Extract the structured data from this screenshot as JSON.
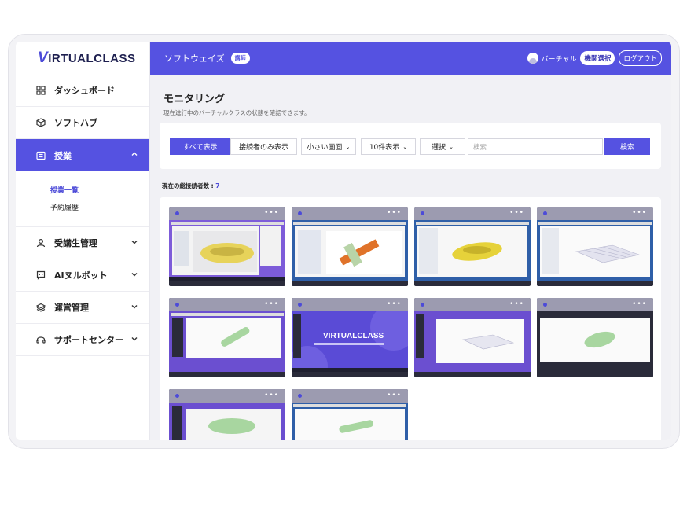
{
  "brand": {
    "logo_v": "V",
    "logo_rest": "IRTUALCLASS"
  },
  "sidebar": {
    "items": [
      {
        "label": "ダッシュボード",
        "icon": "grid-icon"
      },
      {
        "label": "ソフトハブ",
        "icon": "cube-icon"
      },
      {
        "label": "授業",
        "icon": "list-icon",
        "active": true
      },
      {
        "label": "受講生管理",
        "icon": "person-icon"
      },
      {
        "label": "AIヌルボット",
        "icon": "chat-icon"
      },
      {
        "label": "運営管理",
        "icon": "layers-icon"
      },
      {
        "label": "サポートセンター",
        "icon": "headset-icon"
      }
    ],
    "submenu": [
      "授業一覧",
      "予約履歴"
    ]
  },
  "header": {
    "title": "ソフトウェイズ",
    "badge": "講師",
    "user": "バーチャル",
    "org_select": "機関選択",
    "logout": "ログアウト"
  },
  "page": {
    "title": "モニタリング",
    "subtitle": "現在進行中のバーチャルクラスの状態を確認できます。"
  },
  "filters": {
    "show_all": "すべて表示",
    "connected_only": "接続者のみ表示",
    "size_select": "小さい画面",
    "per_page_select": "10件表示",
    "choose_select": "選択",
    "search_placeholder": "検索",
    "search_button": "検索"
  },
  "stats": {
    "label": "現在の総接続者数 :",
    "value": "7"
  },
  "tiles": [
    {
      "menu": "•••",
      "scene": "car-model"
    },
    {
      "menu": "•••",
      "scene": "pipe-model"
    },
    {
      "menu": "•••",
      "scene": "yellow-car"
    },
    {
      "menu": "•••",
      "scene": "mesh-plate"
    },
    {
      "menu": "•••",
      "scene": "cylinder"
    },
    {
      "menu": "•••",
      "scene": "virtualclass-desktop",
      "logo": "VIRTUALCLASS"
    },
    {
      "menu": "•••",
      "scene": "mesh-window"
    },
    {
      "menu": "•••",
      "scene": "green-car"
    },
    {
      "menu": "•••",
      "scene": "purple-desktop"
    },
    {
      "menu": "•••",
      "scene": "pipe-green"
    }
  ],
  "colors": {
    "accent": "#5552e1",
    "sidebar_bg": "#ffffff",
    "page_bg": "#f1f1f5"
  }
}
